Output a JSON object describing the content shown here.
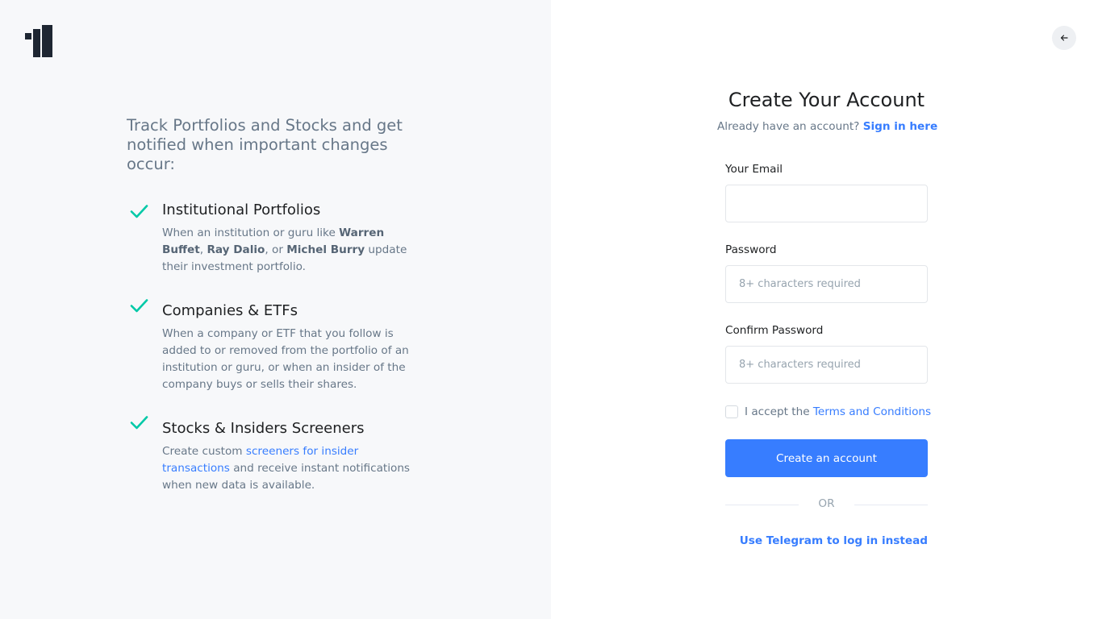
{
  "brand": {
    "logo_icon": "brand-logo-icon",
    "accent": "#377dff",
    "check_color": "#00c9a7"
  },
  "left": {
    "intro": "Track Portfolios and Stocks and get notified when important changes occur:",
    "features": [
      {
        "title": "Institutional Portfolios",
        "icon": "check-icon",
        "desc": {
          "p1": "When an institution or guru like ",
          "b1": "Warren Buffet",
          "p2": ", ",
          "b2": "Ray Dalio",
          "p3": ", or ",
          "b3": "Michel Burry",
          "p4": " update their investment portfolio."
        }
      },
      {
        "title": "Companies & ETFs",
        "icon": "check-icon",
        "desc": "When a company or ETF that you follow is added to or removed from the portfolio of an institution or guru, or when an insider of the company buys or sells their shares."
      },
      {
        "title": "Stocks & Insiders Screeners",
        "icon": "check-icon",
        "desc": {
          "p1": "Create custom ",
          "link": "screeners for insider transactions",
          "p2": " and receive instant notifications when new data is available."
        }
      }
    ]
  },
  "header": {
    "back_icon": "arrow-left-icon"
  },
  "form": {
    "title": "Create Your Account",
    "signin_prompt": "Already have an account?",
    "signin_link": "Sign in here",
    "email_label": "Your Email",
    "email_value": "",
    "password_label": "Password",
    "password_placeholder": "8+ characters required",
    "confirm_label": "Confirm Password",
    "confirm_placeholder": "8+ characters required",
    "terms_prefix": "I accept the",
    "terms_link": "Terms and Conditions",
    "terms_checked": false,
    "submit_label": "Create an account",
    "or_label": "OR",
    "telegram_label": "Use Telegram to log in instead",
    "telegram_icon": "telegram-icon"
  }
}
